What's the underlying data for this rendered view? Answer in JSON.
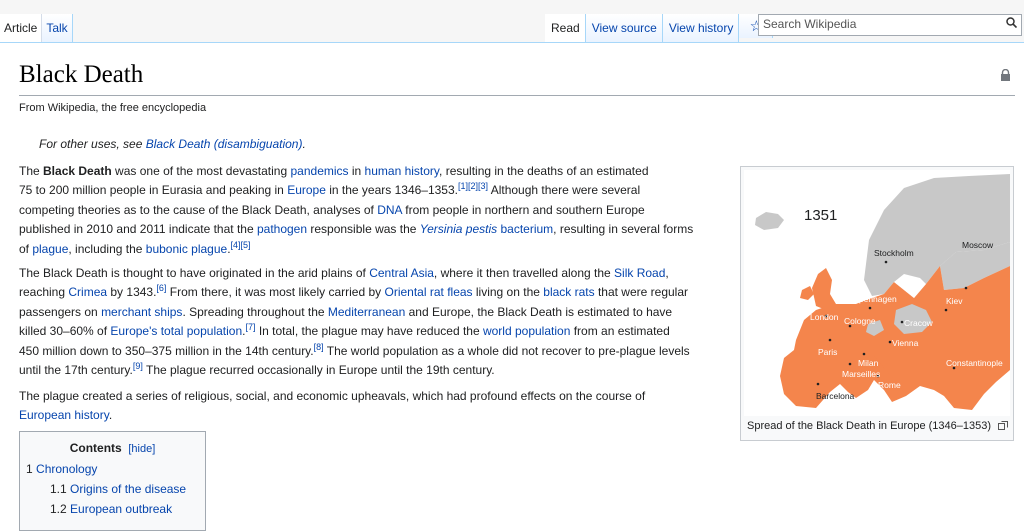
{
  "tabs_left": [
    "Article",
    "Talk"
  ],
  "tabs_right": [
    "Read",
    "View source",
    "View history"
  ],
  "watch_icon": "star-icon",
  "search": {
    "placeholder": "Search Wikipedia",
    "icon": "magnifier-icon"
  },
  "page": {
    "title": "Black Death",
    "tagline": "From Wikipedia, the free encyclopedia",
    "hatnote": {
      "prefix": "For other uses, see ",
      "link": "Black Death (disambiguation)",
      "suffix": "."
    }
  },
  "paragraph1": [
    {
      "t": "The "
    },
    {
      "t": "Black Death",
      "b": true
    },
    {
      "t": " was one of the most devastating "
    },
    {
      "t": "pandemics",
      "l": true
    },
    {
      "t": " in "
    },
    {
      "t": "human history",
      "l": true
    },
    {
      "t": ", resulting in the deaths of an estimated"
    },
    {
      "br": true
    },
    {
      "t": "75 to 200 million people in Eurasia and peaking in "
    },
    {
      "t": "Europe",
      "l": true
    },
    {
      "t": " in the years 1346–1353."
    },
    {
      "t": "[1][2][3]",
      "s": true
    },
    {
      "t": " Although there were several"
    },
    {
      "br": true
    },
    {
      "t": "competing theories as to the cause of the Black Death, analyses of "
    },
    {
      "t": "DNA",
      "l": true
    },
    {
      "t": " from people in northern and southern Europe"
    },
    {
      "br": true
    },
    {
      "t": "published in 2010 and 2011 indicate that the "
    },
    {
      "t": "pathogen",
      "l": true
    },
    {
      "t": " responsible was the "
    },
    {
      "t": "Yersinia pestis",
      "l": true,
      "i": true
    },
    {
      "t": " "
    },
    {
      "t": "bacterium",
      "l": true
    },
    {
      "t": ", resulting in several forms"
    },
    {
      "br": true
    },
    {
      "t": "of "
    },
    {
      "t": "plague",
      "l": true
    },
    {
      "t": ", including the "
    },
    {
      "t": "bubonic plague",
      "l": true
    },
    {
      "t": "."
    },
    {
      "t": "[4][5]",
      "s": true
    }
  ],
  "paragraph2": [
    {
      "t": "The Black Death is thought to have originated in the arid plains of "
    },
    {
      "t": "Central Asia",
      "l": true
    },
    {
      "t": ", where it then travelled along the "
    },
    {
      "t": "Silk Road",
      "l": true
    },
    {
      "t": ","
    },
    {
      "br": true
    },
    {
      "t": "reaching "
    },
    {
      "t": "Crimea",
      "l": true
    },
    {
      "t": " by 1343."
    },
    {
      "t": "[6]",
      "s": true
    },
    {
      "t": " From there, it was most likely carried by "
    },
    {
      "t": "Oriental rat fleas",
      "l": true
    },
    {
      "t": " living on the "
    },
    {
      "t": "black rats",
      "l": true
    },
    {
      "t": " that were regular"
    },
    {
      "br": true
    },
    {
      "t": "passengers on "
    },
    {
      "t": "merchant ships",
      "l": true
    },
    {
      "t": ". Spreading throughout the "
    },
    {
      "t": "Mediterranean",
      "l": true
    },
    {
      "t": " and Europe, the Black Death is estimated to have"
    },
    {
      "br": true
    },
    {
      "t": "killed 30–60% of "
    },
    {
      "t": "Europe's total population",
      "l": true
    },
    {
      "t": "."
    },
    {
      "t": "[7]",
      "s": true
    },
    {
      "t": " In total, the plague may have reduced the "
    },
    {
      "t": "world population",
      "l": true
    },
    {
      "t": " from an estimated"
    },
    {
      "br": true
    },
    {
      "t": "450 million down to 350–375 million in the 14th century."
    },
    {
      "t": "[8]",
      "s": true
    },
    {
      "t": " The world population as a whole did not recover to pre-plague levels"
    },
    {
      "br": true
    },
    {
      "t": "until the 17th century."
    },
    {
      "t": "[9]",
      "s": true
    },
    {
      "t": " The plague recurred occasionally in Europe until the 19th century."
    }
  ],
  "paragraph3": [
    {
      "t": "The plague created a series of religious, social, and economic upheavals, which had profound effects on the course of"
    },
    {
      "br": true
    },
    {
      "t": "European history",
      "l": true
    },
    {
      "t": "."
    }
  ],
  "toc": {
    "title": "Contents",
    "hide_label": "[hide]",
    "items": [
      {
        "num": "1",
        "text": "Chronology"
      },
      {
        "num": "1.1",
        "text": "Origins of the disease"
      },
      {
        "num": "1.2",
        "text": "European outbreak"
      }
    ]
  },
  "figure": {
    "year_label": "1351",
    "cities": [
      "Stockholm",
      "Moscow",
      "Copenhagen",
      "Kiev",
      "London",
      "Cologne",
      "Cracow",
      "Paris",
      "Vienna",
      "Milan",
      "Marseilles",
      "Constantinople",
      "Rome",
      "Barcelona"
    ],
    "caption": "Spread of the Black Death in Europe (1346–1353)",
    "enlarge_icon": "enlarge-icon"
  },
  "colors": {
    "link": "#0645ad",
    "plague": "#f4854c",
    "unaffected": "#c8c8c8"
  }
}
